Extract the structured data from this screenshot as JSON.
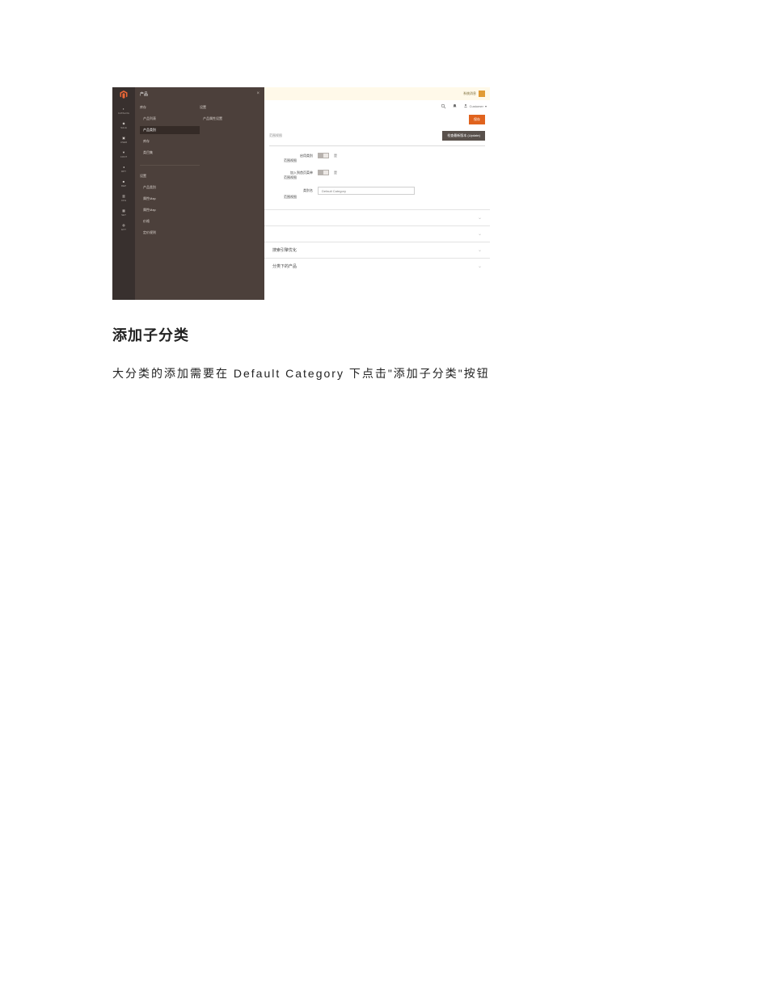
{
  "screenshot": {
    "flyout": {
      "title": "产品",
      "close": "×",
      "colA_header": "库存",
      "colA_items": [
        "产品列表",
        "产品类别",
        "库存",
        "类目集"
      ],
      "colB_header": "设置",
      "colB_items": [
        "产品属性设置"
      ],
      "group2_header": "设置",
      "group2_items": [
        "产品类别",
        "属性Map",
        "属性Map",
        "价格",
        "定价规则"
      ]
    },
    "rail": {
      "items": [
        "CATALOG",
        "SALE",
        "USER",
        "CONT",
        "RPT",
        "REP",
        "CFG",
        "SET",
        "EXT"
      ]
    },
    "notif": {
      "text": "系统消息"
    },
    "tools": {
      "admin": "Customer"
    },
    "save": "保存",
    "scope": {
      "label": "范围视图",
      "button": "检查最新版本 (Update)"
    },
    "form": {
      "row1": {
        "label": "启用类别",
        "toggle": "是"
      },
      "row2": {
        "label": "加入到首页菜单",
        "toggle": "是"
      },
      "row3": {
        "label": "类别名",
        "value": "Default Category"
      },
      "sublab": "范围视图"
    },
    "accordion": {
      "r1": "",
      "r2": "",
      "r3": "搜索引擎优化",
      "r4": "分类下的产品"
    }
  },
  "article": {
    "heading": "添加子分类",
    "paragraph": "大分类的添加需要在 Default Category 下点击\"添加子分类\"按钮"
  }
}
